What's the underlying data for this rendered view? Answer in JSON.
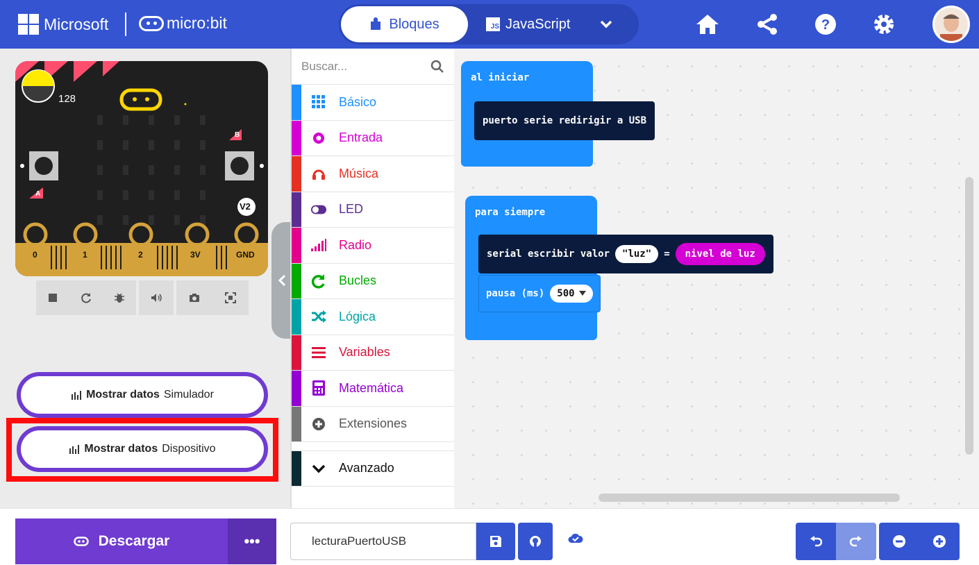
{
  "header": {
    "brand": "Microsoft",
    "product": "micro:bit",
    "mode_blocks": "Bloques",
    "mode_js": "JavaScript",
    "js_badge": "JS"
  },
  "simulator": {
    "light_level": "128",
    "button_a": "A",
    "button_b": "B",
    "version_badge": "V2",
    "pins": [
      "0",
      "1",
      "2",
      "3V",
      "GND"
    ],
    "show_data_sim_label": "Mostrar datos",
    "show_data_sim_target": "Simulador",
    "show_data_dev_label": "Mostrar datos",
    "show_data_dev_target": "Dispositivo"
  },
  "toolbox": {
    "search_placeholder": "Buscar...",
    "categories": [
      {
        "label": "Básico",
        "color": "#1e90ff",
        "icon": "grid-icon"
      },
      {
        "label": "Entrada",
        "color": "#d400d4",
        "icon": "circle-icon"
      },
      {
        "label": "Música",
        "color": "#e63022",
        "icon": "headphones-icon"
      },
      {
        "label": "LED",
        "color": "#5c2d91",
        "icon": "toggle-icon"
      },
      {
        "label": "Radio",
        "color": "#e3008c",
        "icon": "signal-icon"
      },
      {
        "label": "Bucles",
        "color": "#00aa00",
        "icon": "loop-icon"
      },
      {
        "label": "Lógica",
        "color": "#00a4a6",
        "icon": "shuffle-icon"
      },
      {
        "label": "Variables",
        "color": "#dc143c",
        "icon": "lines-icon"
      },
      {
        "label": "Matemática",
        "color": "#9400d3",
        "icon": "calculator-icon"
      },
      {
        "label": "Extensiones",
        "color": "#777777",
        "icon": "plus-circle-icon"
      },
      {
        "label": "Avanzado",
        "color": "#0b2a33",
        "icon": "chevron-down-icon"
      }
    ]
  },
  "workspace": {
    "on_start": "al iniciar",
    "serial_redirect": "puerto serie redirigir a USB",
    "forever": "para siempre",
    "serial_write": "serial escribir valor",
    "serial_key": "luz",
    "equals": "=",
    "light_level_block": "nivel de luz",
    "pause": "pausa (ms)",
    "pause_value": "500"
  },
  "footer": {
    "download": "Descargar",
    "more": "•••",
    "project_name": "lecturaPuertoUSB"
  },
  "colors": {
    "header_blue": "#3454d1",
    "purple": "#6f3bd1",
    "highlight_red": "#ff0d0d",
    "block_blue": "#1e90ff",
    "serial_navy": "#0b1b3d",
    "input_magenta": "#d400d4"
  }
}
